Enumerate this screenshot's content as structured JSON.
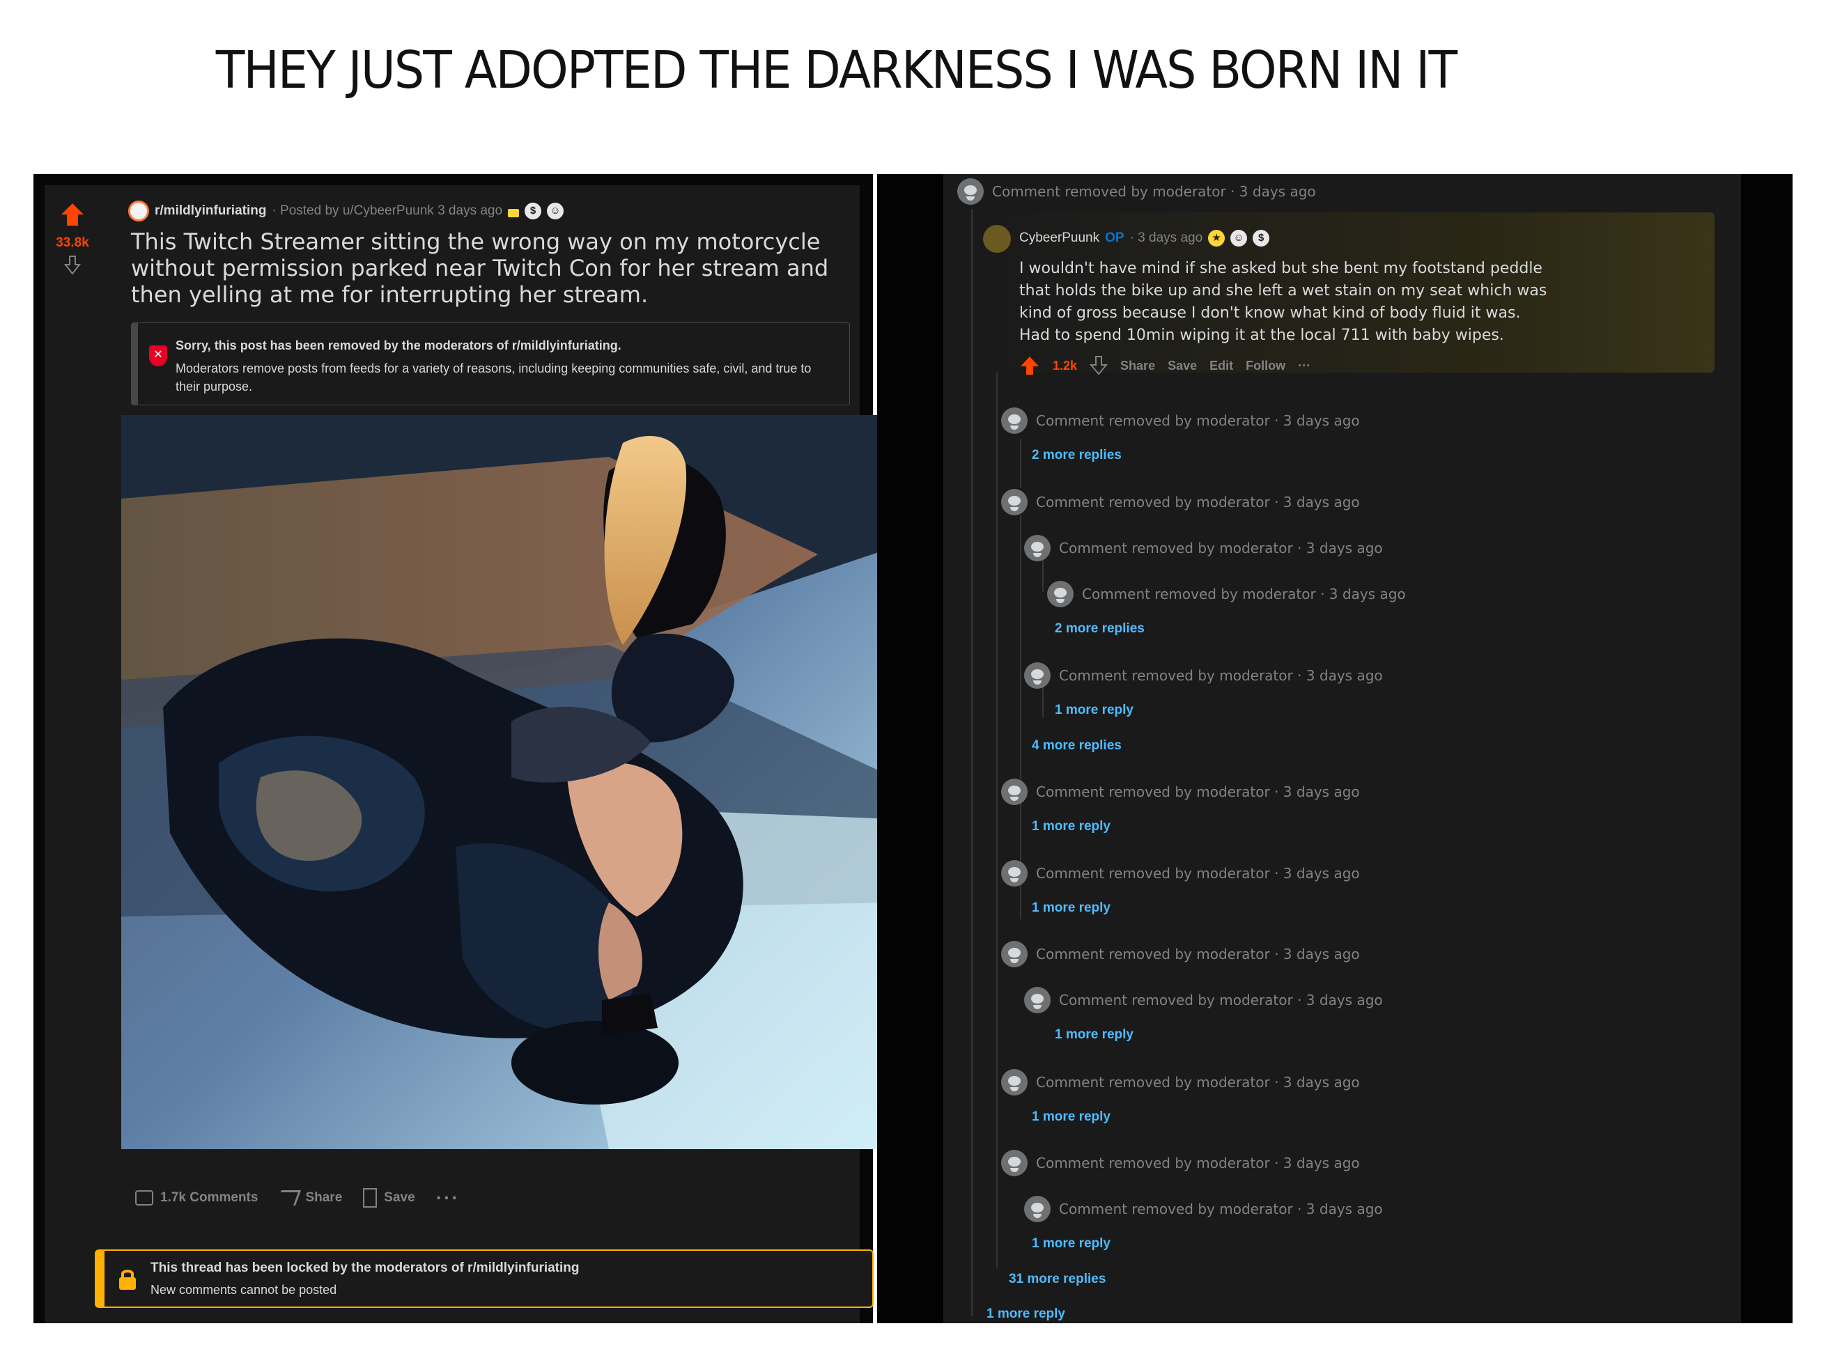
{
  "caption": "THEY JUST ADOPTED THE DARKNESS I WAS BORN IN IT",
  "post": {
    "score": "33.8k",
    "subreddit": "r/mildlyinfuriating",
    "posted_by": "· Posted by u/CybeerPuunk 3 days ago",
    "award_icons": [
      "lock-icon",
      "silver-award-icon",
      "hug-award-icon"
    ],
    "award_glyph_1": "$",
    "award_glyph_2": "☺",
    "title": "This Twitch Streamer sitting the wrong way on my motorcycle without permission parked near Twitch Con for her stream and then yelling at me for interrupting her stream.",
    "removed_notice": {
      "title": "Sorry, this post has been removed by the moderators of r/mildlyinfuriating.",
      "text": "Moderators remove posts from feeds for a variety of reasons, including keeping communities safe, civil, and true to their purpose."
    },
    "actions": {
      "comments": "1.7k Comments",
      "share": "Share",
      "save": "Save",
      "more": "···"
    },
    "locked_notice": {
      "title": "This thread has been locked by the moderators of r/mildlyinfuriating",
      "text": "New comments cannot be posted"
    }
  },
  "comments": {
    "top_removed": "Comment removed by moderator · 3 days ago",
    "op_comment": {
      "user": "CybeerPuunk",
      "op_tag": "OP",
      "time": "· 3 days ago",
      "body": "I wouldn't have mind if she asked but she bent my footstand peddle that holds the bike up and she left a wet stain on my seat which was kind of gross because I don't know what kind of body fluid it was. Had to spend 10min wiping it at the local 711 with baby wipes.",
      "score": "1.2k",
      "actions": [
        "Share",
        "Save",
        "Edit",
        "Follow",
        "···"
      ]
    },
    "removed_text": "Comment removed by moderator · 3 days ago",
    "more_2_replies": "2 more replies",
    "more_1_reply": "1 more reply",
    "more_4_replies": "4 more replies",
    "more_31_replies": "31 more replies"
  },
  "colors": {
    "upvote": "#ff4500",
    "link": "#4fbcff",
    "locked_border": "#ffb000",
    "removed_icon": "#ea0027"
  }
}
